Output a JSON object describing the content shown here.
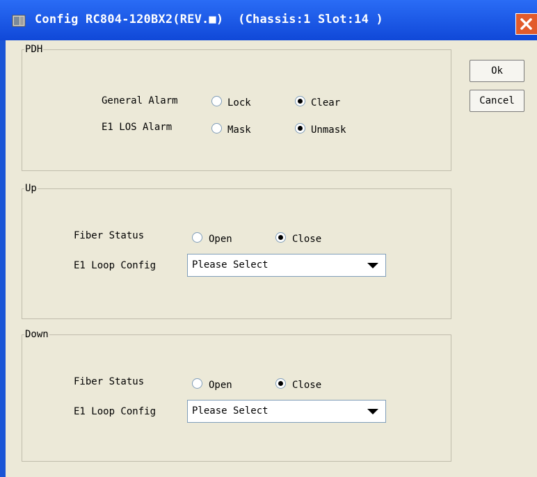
{
  "window": {
    "title": "Config RC804-120BX2(REV.■)  (Chassis:1 Slot:14 )",
    "icon": "app-window-icon",
    "close_icon": "close-icon"
  },
  "buttons": {
    "ok": "Ok",
    "cancel": "Cancel"
  },
  "pdh": {
    "label": "PDH",
    "general_alarm": {
      "label": "General Alarm",
      "options": [
        "Lock",
        "Clear"
      ],
      "selected": "Clear"
    },
    "e1_los_alarm": {
      "label": "E1 LOS Alarm",
      "options": [
        "Mask",
        "Unmask"
      ],
      "selected": "Unmask"
    }
  },
  "up": {
    "label": "Up",
    "fiber_status": {
      "label": "Fiber Status",
      "options": [
        "Open",
        "Close"
      ],
      "selected": "Close"
    },
    "e1_loop_config": {
      "label": "E1 Loop Config",
      "value": "Please Select"
    }
  },
  "down": {
    "label": "Down",
    "fiber_status": {
      "label": "Fiber Status",
      "options": [
        "Open",
        "Close"
      ],
      "selected": "Close"
    },
    "e1_loop_config": {
      "label": "E1 Loop Config",
      "value": "Please Select"
    }
  },
  "colors": {
    "titlebar": "#1a55d6",
    "panel": "#ece9d8",
    "close": "#e25b2b"
  }
}
